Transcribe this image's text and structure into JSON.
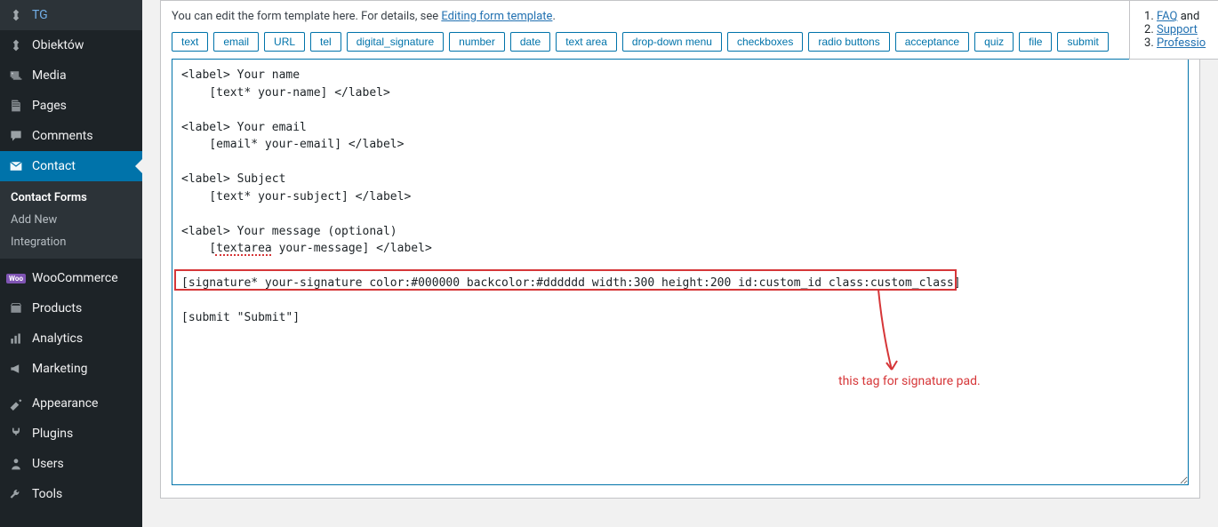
{
  "sidebar": {
    "items": [
      {
        "label": "TG",
        "icon": "pin"
      },
      {
        "label": "Obiektów",
        "icon": "pin"
      },
      {
        "label": "Media",
        "icon": "media"
      },
      {
        "label": "Pages",
        "icon": "page"
      },
      {
        "label": "Comments",
        "icon": "comment"
      },
      {
        "label": "Contact",
        "icon": "mail"
      },
      {
        "label": "WooCommerce",
        "icon": "woo"
      },
      {
        "label": "Products",
        "icon": "products"
      },
      {
        "label": "Analytics",
        "icon": "analytics"
      },
      {
        "label": "Marketing",
        "icon": "marketing"
      },
      {
        "label": "Appearance",
        "icon": "appearance"
      },
      {
        "label": "Plugins",
        "icon": "plugins"
      },
      {
        "label": "Users",
        "icon": "users"
      },
      {
        "label": "Tools",
        "icon": "tools"
      }
    ],
    "submenu": [
      {
        "label": "Contact Forms",
        "current": true
      },
      {
        "label": "Add New",
        "current": false
      },
      {
        "label": "Integration",
        "current": false
      }
    ]
  },
  "panel": {
    "description_prefix": "You can edit the form template here. For details, see ",
    "description_link": "Editing form template",
    "description_suffix": ".",
    "tags": [
      "text",
      "email",
      "URL",
      "tel",
      "digital_signature",
      "number",
      "date",
      "text area",
      "drop-down menu",
      "checkboxes",
      "radio buttons",
      "acceptance",
      "quiz",
      "file",
      "submit"
    ],
    "textarea_value": "<label> Your name\n    [text* your-name] </label>\n\n<label> Your email\n    [email* your-email] </label>\n\n<label> Subject\n    [text* your-subject] </label>\n\n<label> Your message (optional)\n    [textarea your-message] </label>\n\n[signature* your-signature color:#000000 backcolor:#dddddd width:300 height:200 id:custom_id class:custom_class]\n\n[submit \"Submit\"]"
  },
  "annotation": {
    "label": "this tag for signature pad."
  },
  "right_panel": {
    "items": [
      "FAQ",
      "Support",
      "Professio"
    ]
  }
}
